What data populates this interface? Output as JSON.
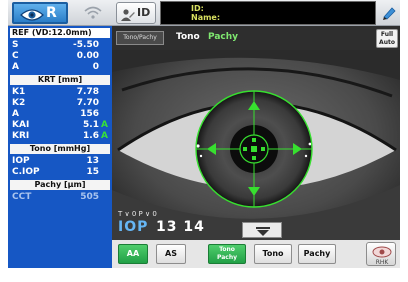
{
  "top_bar": {
    "eye_side": "R",
    "id_button_label": "ID",
    "id_field_label": "ID:",
    "name_field_label": "Name:"
  },
  "left_panel": {
    "ref": {
      "title": "REF (VD:12.0mm)",
      "rows": [
        {
          "key": "S",
          "value": "-5.50"
        },
        {
          "key": "C",
          "value": "0.00"
        },
        {
          "key": "A",
          "value": "0"
        }
      ]
    },
    "krt": {
      "title": "KRT [mm]",
      "rows": [
        {
          "key": "K1",
          "value": "7.78",
          "flag": ""
        },
        {
          "key": "K2",
          "value": "7.70",
          "flag": ""
        },
        {
          "key": "A",
          "value": "156",
          "flag": ""
        },
        {
          "key": "KAI",
          "value": "5.1",
          "flag": "A"
        },
        {
          "key": "KRI",
          "value": "1.6",
          "flag": "A"
        }
      ]
    },
    "tono": {
      "title": "Tono [mmHg]",
      "rows": [
        {
          "key": "IOP",
          "value": "13"
        },
        {
          "key": "C.IOP",
          "value": "15"
        }
      ]
    },
    "pachy": {
      "title": "Pachy [µm]",
      "rows": [
        {
          "key": "CCT",
          "value": "505"
        }
      ]
    }
  },
  "camera": {
    "tono_pachy_button": "Tono/Pachy",
    "mode_primary": "Tono",
    "mode_secondary": "Pachy",
    "full_auto_label_1": "Full",
    "full_auto_label_2": "Auto",
    "overlay_small": "T ∨ 0 P ∨ 0",
    "iop_label": "IOP",
    "iop_value": "13 14"
  },
  "bottom_bar": {
    "aa_label": "AA",
    "as_label": "AS",
    "tono_pachy_line1": "Tono",
    "tono_pachy_line2": "Pachy",
    "tono_label": "Tono",
    "pachy_label": "Pachy",
    "rhk_label": "RHK"
  },
  "colors": {
    "panel_blue": "#1657c4",
    "active_green": "#21a046",
    "alignment_green": "#37e02f",
    "flag_green": "#36e03a"
  },
  "icons": [
    "eye-icon",
    "wifi-icon",
    "person-icon",
    "pen-icon",
    "down-arrow-icon",
    "rhk-icon"
  ]
}
